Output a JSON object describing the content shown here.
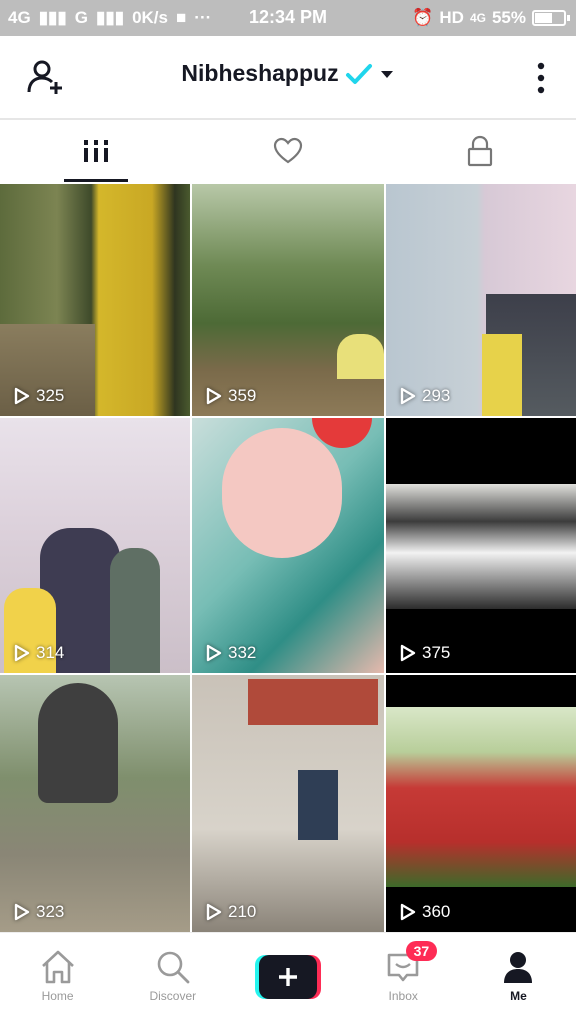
{
  "status_bar": {
    "signal_left": "4G",
    "signal_right_label": "G",
    "speed": "0K/s",
    "time": "12:34 PM",
    "hd": "HD",
    "network": "4G",
    "battery": "55%",
    "battery_level": 0.55
  },
  "header": {
    "username": "Nibheshappuz",
    "verified": true
  },
  "tabs": [
    {
      "name": "videos",
      "active": true
    },
    {
      "name": "liked",
      "active": false
    },
    {
      "name": "private",
      "active": false
    }
  ],
  "videos": [
    {
      "views": "325"
    },
    {
      "views": "359"
    },
    {
      "views": "293"
    },
    {
      "views": "314"
    },
    {
      "views": "332"
    },
    {
      "views": "375"
    },
    {
      "views": "323"
    },
    {
      "views": "210"
    },
    {
      "views": "360"
    }
  ],
  "bottom_nav": {
    "home": "Home",
    "discover": "Discover",
    "inbox": "Inbox",
    "inbox_badge": "37",
    "me": "Me"
  },
  "colors": {
    "accent_red": "#fe2c55",
    "accent_cyan": "#25f4ee",
    "verified_blue": "#20d5ec",
    "text_dark": "#161823"
  }
}
